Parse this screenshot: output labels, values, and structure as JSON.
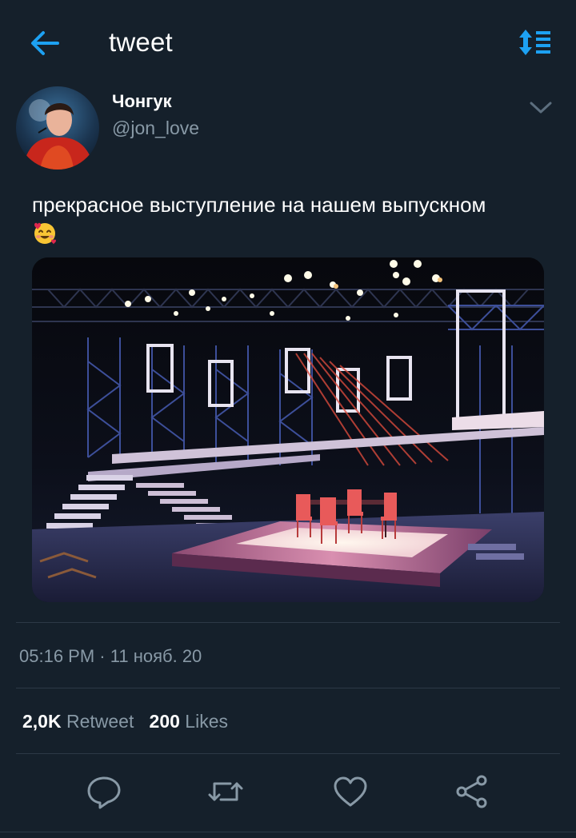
{
  "header": {
    "title": "tweet",
    "back_icon": "arrow-left-icon",
    "sort_icon": "sort-lines-icon",
    "accent_color": "#1da1f2"
  },
  "author": {
    "name": "Чонгук",
    "handle": "@jon_love"
  },
  "tweet": {
    "text": "прекрасное выступление на нашем выпускном",
    "emoji": "smiling-face-with-hearts",
    "media_icon": "theatre-stage-photo"
  },
  "timestamp": {
    "time": "05:16 PM",
    "separator": "·",
    "date": "11 нояб. 20"
  },
  "stats": {
    "retweets_count": "2,0K",
    "retweets_label": "Retweet",
    "likes_count": "200",
    "likes_label": "Likes"
  },
  "actions": [
    "reply-icon",
    "retweet-icon",
    "like-icon",
    "share-icon"
  ],
  "colors": {
    "background": "#15202b",
    "secondary_text": "#8899a6",
    "divider": "#2c3946"
  }
}
